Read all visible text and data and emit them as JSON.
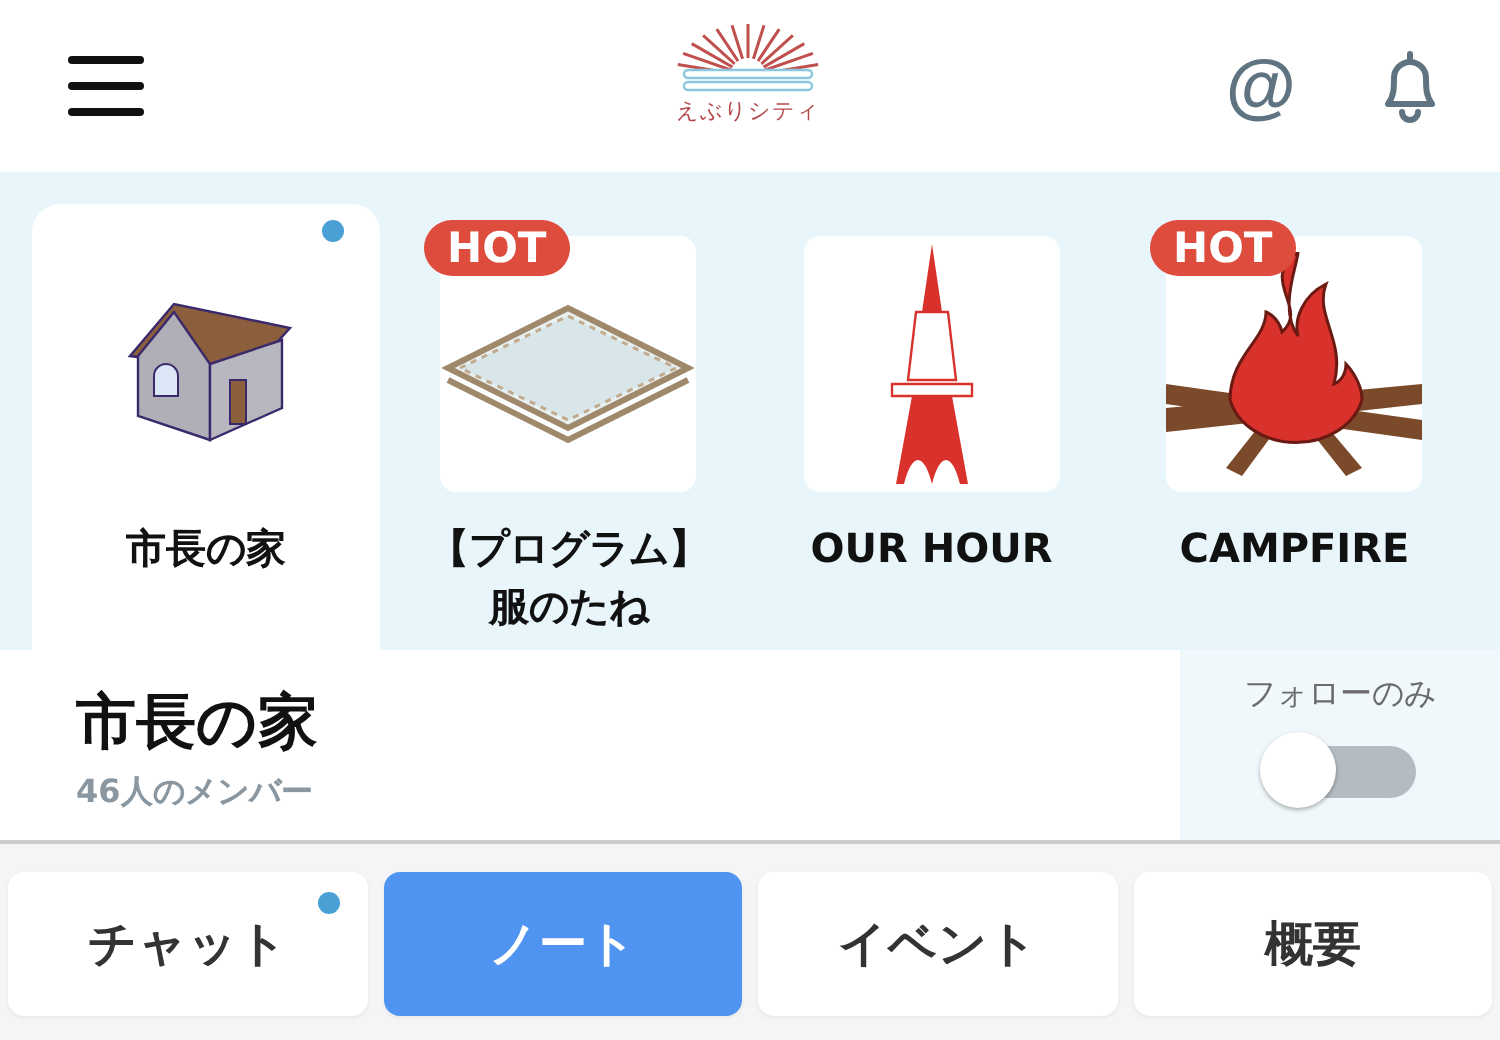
{
  "header": {
    "logo_text": "えぶりシティ",
    "mention_icon": "@"
  },
  "channels": [
    {
      "name_lines": [
        "市長の家"
      ],
      "kind": "house",
      "selected": true,
      "unread": true
    },
    {
      "name_lines": [
        "【プログラム】",
        "服のたね"
      ],
      "kind": "field",
      "selected": false,
      "badge": "HOT",
      "unread": false
    },
    {
      "name_lines": [
        "OUR HOUR"
      ],
      "kind": "tower",
      "selected": false,
      "unread": false
    },
    {
      "name_lines": [
        "CAMPFIRE"
      ],
      "kind": "fire",
      "selected": false,
      "badge": "HOT",
      "unread": false
    }
  ],
  "current": {
    "title": "市長の家",
    "members": "46人のメンバー"
  },
  "follow_filter": {
    "label": "フォローのみ",
    "on": false
  },
  "tabs": [
    {
      "label": "チャット",
      "selected": false,
      "unread": true
    },
    {
      "label": "ノート",
      "selected": true,
      "unread": false
    },
    {
      "label": "イベント",
      "selected": false,
      "unread": false
    },
    {
      "label": "概要",
      "selected": false,
      "unread": false
    }
  ]
}
